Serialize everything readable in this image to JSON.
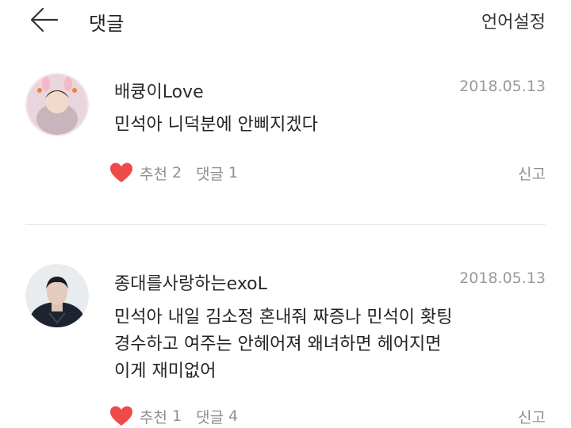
{
  "header": {
    "back_icon": "arrow-left-icon",
    "title": "댓글",
    "language_setting": "언어설정"
  },
  "colors": {
    "heart": "#ef4a4a",
    "muted_text": "#9a9a9a",
    "divider": "#e6e6e6"
  },
  "comments": [
    {
      "author": "배큥이Love",
      "date": "2018.05.13",
      "text_lines": [
        "민석아 니덕분에 안삐지겠다"
      ],
      "recommend_label": "추천",
      "recommend_count": "2",
      "reply_label": "댓글",
      "reply_count": "1",
      "report_label": "신고"
    },
    {
      "author": "종대를사랑하는exoL",
      "date": "2018.05.13",
      "text_lines": [
        "민석아 내일 김소정 혼내줘 짜증나 민석이 홧팅",
        "경수하고 여주는 안헤어져 왜녀하면 헤어지면",
        "이게 재미없어"
      ],
      "recommend_label": "추천",
      "recommend_count": "1",
      "reply_label": "댓글",
      "reply_count": "4",
      "report_label": "신고"
    }
  ]
}
